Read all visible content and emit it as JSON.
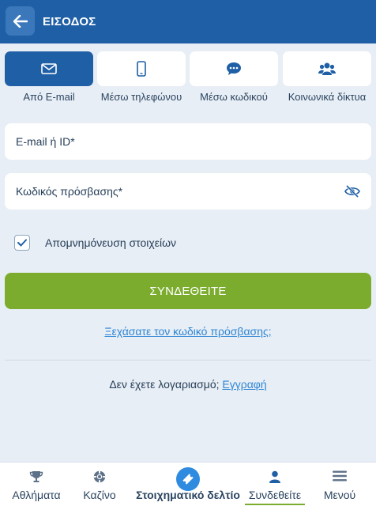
{
  "header": {
    "title": "ΕΙΣΟΔΟΣ",
    "back_icon": "arrow-left-icon"
  },
  "tabs": [
    {
      "label": "Από E-mail",
      "icon": "envelope-icon",
      "active": true
    },
    {
      "label": "Μέσω τηλεφώνου",
      "icon": "mobile-phone-icon",
      "active": false
    },
    {
      "label": "Μέσω κωδικού",
      "icon": "chat-bubble-icon",
      "active": false
    },
    {
      "label": "Κοινωνικά δίκτυα",
      "icon": "users-icon",
      "active": false
    }
  ],
  "form": {
    "email_label": "E-mail ή ID*",
    "password_label": "Κωδικός πρόσβασης*",
    "remember_label": "Απομνημόνευση στοιχείων",
    "remember_checked": true,
    "submit_label": "ΣΥΝΔΕΘΕΙΤΕ",
    "forgot_label": "Ξεχάσατε τον κωδικό πρόσβασης;"
  },
  "register": {
    "prompt": "Δεν έχετε λογαριασμό;",
    "link": "Εγγραφή"
  },
  "bottom_nav": [
    {
      "label": "Αθλήματα",
      "icon": "trophy-icon"
    },
    {
      "label": "Καζίνο",
      "icon": "casino-chip-icon"
    },
    {
      "label": "Στοιχηματικό δελτίο",
      "icon": "ticket-icon"
    },
    {
      "label": "Συνδεθείτε",
      "icon": "user-icon",
      "active": true
    },
    {
      "label": "Μενού",
      "icon": "menu-icon"
    }
  ],
  "colors": {
    "primary": "#1f5fa6",
    "accent_green": "#7bac2e",
    "link_blue": "#2f86d4",
    "background": "#e8eef5"
  }
}
